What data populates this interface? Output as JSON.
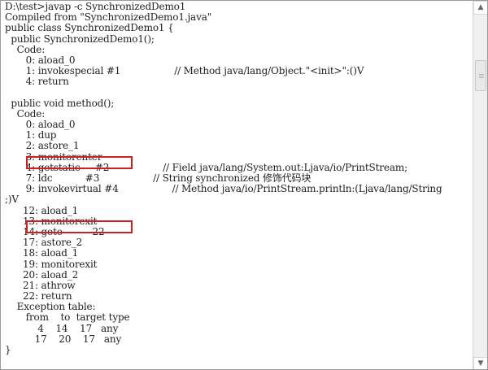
{
  "console": {
    "lines": [
      "D:\\test>javap -c SynchronizedDemo1",
      "Compiled from \"SynchronizedDemo1.java\"",
      "public class SynchronizedDemo1 {",
      "  public SynchronizedDemo1();",
      "    Code:",
      "       0: aload_0",
      "       1: invokespecial #1                  // Method java/lang/Object.\"<init>\":()V",
      "       4: return",
      "",
      "  public void method();",
      "    Code:",
      "       0: aload_0",
      "       1: dup",
      "       2: astore_1",
      "       3: monitorenter",
      "       4: getstatic     #2                  // Field java/lang/System.out:Ljava/io/PrintStream;",
      "       7: ldc           #3                  // String synchronized 修饰代码块",
      "       9: invokevirtual #4                  // Method java/io/PrintStream.println:(Ljava/lang/String",
      ";)V",
      "      12: aload_1",
      "      13: monitorexit",
      "      14: goto          22",
      "      17: astore_2",
      "      18: aload_1",
      "      19: monitorexit",
      "      20: aload_2",
      "      21: athrow",
      "      22: return",
      "    Exception table:",
      "       from    to  target type",
      "           4    14    17   any",
      "          17    20    17   any",
      "}"
    ]
  },
  "highlights": [
    {
      "label": "monitorenter"
    },
    {
      "label": "monitorexit"
    }
  ],
  "icons": {
    "scroll_up": "chevron-up-icon",
    "scroll_down": "chevron-down-icon"
  },
  "colors": {
    "highlight": "#cc1f1f",
    "text": "#1f1f1f",
    "background": "#ffffff"
  }
}
